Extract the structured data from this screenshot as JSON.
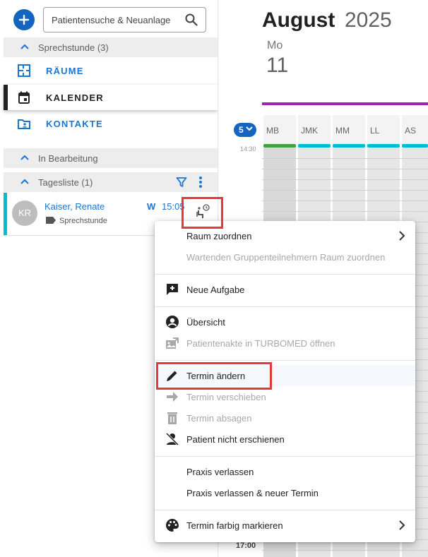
{
  "sidebar": {
    "search": {
      "placeholder": "Patientensuche & Neuanlage"
    },
    "sections": {
      "sprechstunde": "Sprechstunde (3)",
      "in_bearbeitung": "In Bearbeitung",
      "tagesliste": "Tagesliste (1)"
    },
    "nav": {
      "raeume": "RÄUME",
      "kalender": "KALENDER",
      "kontakte": "KONTAKTE"
    }
  },
  "patient": {
    "initials": "KR",
    "name": "Kaiser, Renate",
    "type": "Sprechstunde",
    "marker": "W",
    "time": "15:05"
  },
  "calendar": {
    "month": "August",
    "year": "2025",
    "weekday": "Mo",
    "day": "11",
    "badge_count": "5",
    "time_top": "14:30",
    "time_bottom": "17:00",
    "columns": [
      {
        "name": "MB",
        "color": "#43a047"
      },
      {
        "name": "JMK",
        "color": "#00bcd4"
      },
      {
        "name": "MM",
        "color": "#00bcd4"
      },
      {
        "name": "LL",
        "color": "#00bcd4"
      },
      {
        "name": "AS",
        "color": "#00bcd4"
      }
    ]
  },
  "menu": {
    "raum_zuordnen": "Raum zuordnen",
    "gruppe_raum": "Wartenden Gruppenteilnehmern Raum zuordnen",
    "neue_aufgabe": "Neue Aufgabe",
    "uebersicht": "Übersicht",
    "patientenakte": "Patientenakte in TURBOMED öffnen",
    "termin_aendern": "Termin ändern",
    "termin_verschieben": "Termin verschieben",
    "termin_absagen": "Termin absagen",
    "nicht_erschienen": "Patient nicht erschienen",
    "praxis_verlassen": "Praxis verlassen",
    "praxis_verlassen_neu": "Praxis verlassen & neuer Termin",
    "farbig_markieren": "Termin farbig markieren"
  },
  "colors": {
    "primary": "#1976d2",
    "accent_purple": "#9c27b0",
    "highlight": "#e53935",
    "patient_bar": "#00bcd4"
  }
}
